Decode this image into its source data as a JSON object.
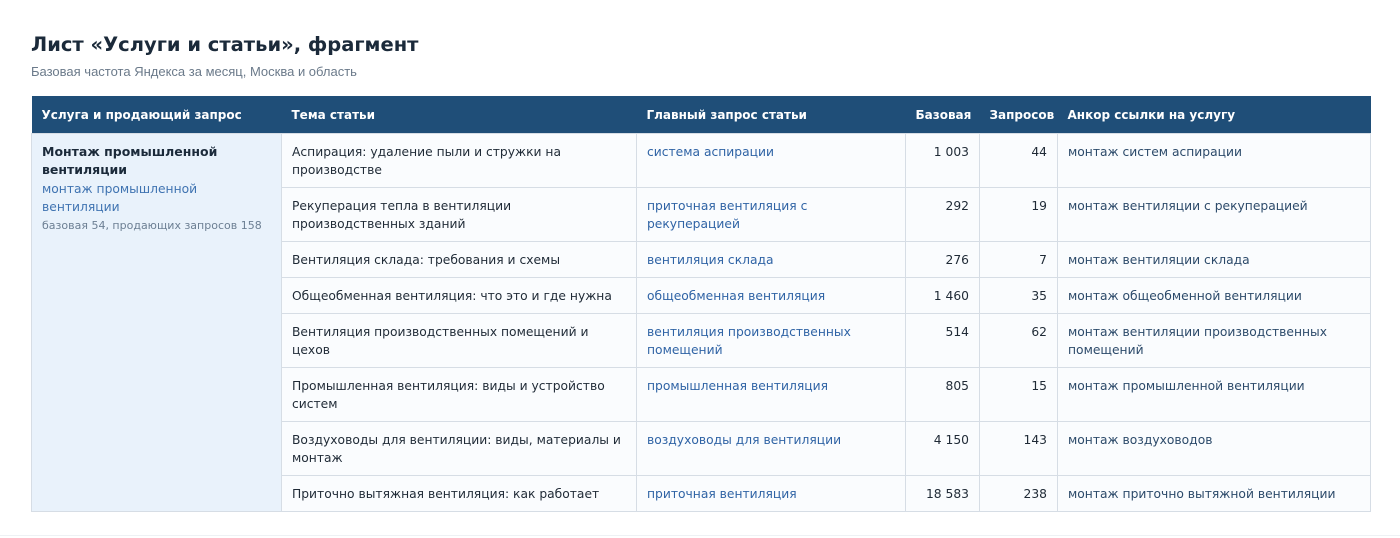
{
  "page": {
    "title": "Лист «Услуги и статьи», фрагмент",
    "subtitle": "Базовая частота Яндекса за месяц, Москва и область"
  },
  "table": {
    "headers": {
      "service": "Услуга и продающий запрос",
      "topic": "Тема статьи",
      "main_query": "Главный запрос статьи",
      "base": "Базовая",
      "queries": "Запросов",
      "anchor": "Анкор ссылки на услугу"
    },
    "service": {
      "title": "Монтаж промышленной вентиляции",
      "query": "монтаж промышленной вентиляции",
      "meta": "базовая 54, продающих запросов 158"
    },
    "rows": [
      {
        "topic": "Аспирация: удаление пыли и стружки на производстве",
        "query": "система аспирации",
        "base": "1 003",
        "count": "44",
        "anchor": "монтаж систем аспирации"
      },
      {
        "topic": "Рекуперация тепла в вентиляции производственных зданий",
        "query": "приточная вентиляция с рекуперацией",
        "base": "292",
        "count": "19",
        "anchor": "монтаж вентиляции с рекуперацией"
      },
      {
        "topic": "Вентиляция склада: требования и схемы",
        "query": "вентиляция склада",
        "base": "276",
        "count": "7",
        "anchor": "монтаж вентиляции склада"
      },
      {
        "topic": "Общеобменная вентиляция: что это и где нужна",
        "query": "общеобменная вентиляция",
        "base": "1 460",
        "count": "35",
        "anchor": "монтаж общеобменной вентиляции"
      },
      {
        "topic": "Вентиляция производственных помещений и цехов",
        "query": "вентиляция производственных помещений",
        "base": "514",
        "count": "62",
        "anchor": "монтаж вентиляции производственных помещений"
      },
      {
        "topic": "Промышленная вентиляция: виды и устройство систем",
        "query": "промышленная вентиляция",
        "base": "805",
        "count": "15",
        "anchor": "монтаж промышленной вентиляции"
      },
      {
        "topic": "Воздуховоды для вентиляции: виды, материалы и монтаж",
        "query": "воздуховоды для вентиляции",
        "base": "4 150",
        "count": "143",
        "anchor": "монтаж воздуховодов"
      },
      {
        "topic": "Приточно вытяжная вентиляция: как работает",
        "query": "приточная вентиляция",
        "base": "18 583",
        "count": "238",
        "anchor": "монтаж приточно вытяжной вентиляции"
      }
    ]
  }
}
